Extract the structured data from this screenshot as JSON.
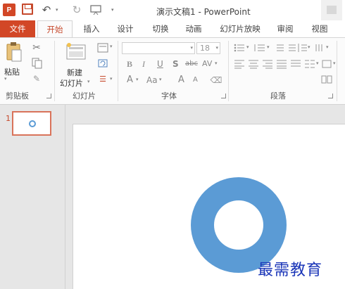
{
  "window": {
    "title": "演示文稿1 - PowerPoint",
    "app_logo_text": "P"
  },
  "quick_access": {
    "undo": "↶",
    "redo": "↻",
    "dropdown": "▾",
    "customize": "▾"
  },
  "tabs": [
    {
      "label": "文件"
    },
    {
      "label": "开始"
    },
    {
      "label": "插入"
    },
    {
      "label": "设计"
    },
    {
      "label": "切换"
    },
    {
      "label": "动画"
    },
    {
      "label": "幻灯片放映"
    },
    {
      "label": "审阅"
    },
    {
      "label": "视图"
    }
  ],
  "ribbon": {
    "clipboard": {
      "label": "剪贴板",
      "paste": "粘贴"
    },
    "slides": {
      "label": "幻灯片",
      "new_slide_line1": "新建",
      "new_slide_line2": "幻灯片"
    },
    "font": {
      "label": "字体",
      "font_name": "",
      "font_size": "18",
      "bold": "B",
      "italic": "I",
      "underline": "U",
      "shadow": "S",
      "strike": "abc",
      "spacing": "AV",
      "font_color": "A",
      "change_case": "Aa",
      "grow": "A",
      "shrink": "A"
    },
    "paragraph": {
      "label": "段落"
    }
  },
  "slide_pane": {
    "thumb_number": "1"
  },
  "colors": {
    "accent": "#d24726",
    "shape_fill": "#5b9bd5",
    "watermark": "#1a35b8"
  },
  "watermark": "最需教育"
}
